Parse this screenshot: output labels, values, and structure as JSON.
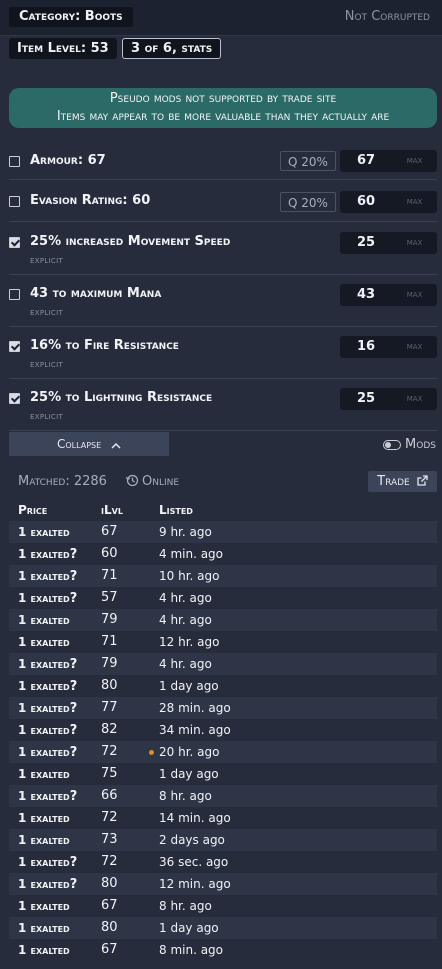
{
  "header": {
    "category": "Category: Boots",
    "corrupted": "Not Corrupted",
    "item_level": "Item Level: 53",
    "stats_chip": "3 of 6, stats"
  },
  "banner": {
    "line1": "Pseudo mods not supported by trade site",
    "line2": "Items may appear to be more valuable than they actually are"
  },
  "stats": [
    {
      "label": "Armour: ",
      "value": "67",
      "checked": false,
      "quality": "Q 20%",
      "input": "67",
      "max": "max",
      "source": ""
    },
    {
      "label": "Evasion Rating: ",
      "value": "60",
      "checked": false,
      "quality": "Q 20%",
      "input": "60",
      "max": "max",
      "source": ""
    },
    {
      "label": "25% increased Movement Speed",
      "checked": true,
      "input": "25",
      "max": "max",
      "source": "explicit"
    },
    {
      "label": "43 to maximum Mana",
      "checked": false,
      "input": "43",
      "max": "max",
      "source": "explicit"
    },
    {
      "label": "16% to Fire Resistance",
      "checked": true,
      "input": "16",
      "max": "max",
      "source": "explicit"
    },
    {
      "label": "25% to Lightning Resistance",
      "checked": true,
      "input": "25",
      "max": "max",
      "source": "explicit"
    }
  ],
  "controls": {
    "collapse": "Collapse",
    "mods": "Mods"
  },
  "results": {
    "matched": "Matched: 2286",
    "online": "Online",
    "trade": "Trade",
    "columns": {
      "price": "Price",
      "ilvl": "iLvl",
      "listed": "Listed"
    },
    "rows": [
      {
        "price": "1 exalted",
        "uncertain": false,
        "ilvl": "67",
        "listed": "9 hr. ago"
      },
      {
        "price": "1 exalted",
        "uncertain": true,
        "ilvl": "60",
        "listed": "4 min. ago"
      },
      {
        "price": "1 exalted",
        "uncertain": true,
        "ilvl": "71",
        "listed": "10 hr. ago"
      },
      {
        "price": "1 exalted",
        "uncertain": true,
        "ilvl": "57",
        "listed": "4 hr. ago"
      },
      {
        "price": "1 exalted",
        "uncertain": false,
        "ilvl": "79",
        "listed": "4 hr. ago"
      },
      {
        "price": "1 exalted",
        "uncertain": false,
        "ilvl": "71",
        "listed": "12 hr. ago"
      },
      {
        "price": "1 exalted",
        "uncertain": true,
        "ilvl": "79",
        "listed": "4 hr. ago"
      },
      {
        "price": "1 exalted",
        "uncertain": true,
        "ilvl": "80",
        "listed": "1 day ago"
      },
      {
        "price": "1 exalted",
        "uncertain": true,
        "ilvl": "77",
        "listed": "28 min. ago"
      },
      {
        "price": "1 exalted",
        "uncertain": true,
        "ilvl": "82",
        "listed": "34 min. ago"
      },
      {
        "price": "1 exalted",
        "uncertain": true,
        "ilvl": "72",
        "listed": "20 hr. ago",
        "dot": true
      },
      {
        "price": "1 exalted",
        "uncertain": false,
        "ilvl": "75",
        "listed": "1 day ago"
      },
      {
        "price": "1 exalted",
        "uncertain": true,
        "ilvl": "66",
        "listed": "8 hr. ago"
      },
      {
        "price": "1 exalted",
        "uncertain": false,
        "ilvl": "72",
        "listed": "14 min. ago"
      },
      {
        "price": "1 exalted",
        "uncertain": false,
        "ilvl": "73",
        "listed": "2 days ago"
      },
      {
        "price": "1 exalted",
        "uncertain": true,
        "ilvl": "72",
        "listed": "36 sec. ago"
      },
      {
        "price": "1 exalted",
        "uncertain": true,
        "ilvl": "80",
        "listed": "12 min. ago"
      },
      {
        "price": "1 exalted",
        "uncertain": false,
        "ilvl": "67",
        "listed": "8 hr. ago"
      },
      {
        "price": "1 exalted",
        "uncertain": false,
        "ilvl": "80",
        "listed": "1 day ago"
      },
      {
        "price": "1 exalted",
        "uncertain": false,
        "ilvl": "67",
        "listed": "8 min. ago"
      }
    ]
  },
  "colors": {
    "background": "#262c3b",
    "banner": "#2c6a67",
    "accent_dot": "#e08a2c"
  }
}
